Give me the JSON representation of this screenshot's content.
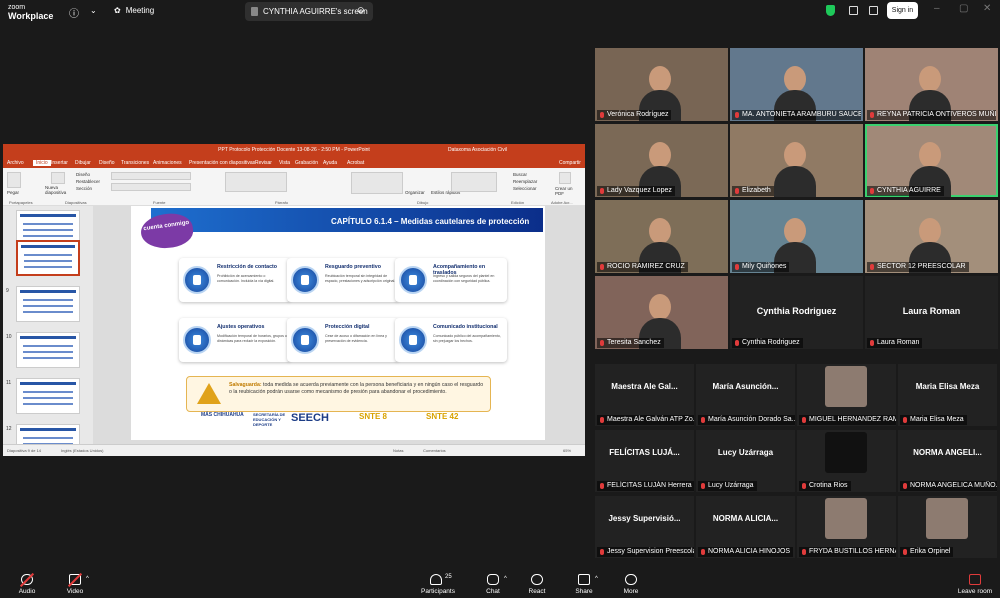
{
  "topbar": {
    "brand_small": "zoom",
    "brand_name": "Workplace",
    "meeting_label": "Meeting",
    "share_tab": "CYNTHIA AGUIRRE's screen",
    "sign_in": "Sign in"
  },
  "ppt": {
    "window_title": "PPT Protocolo Protección Docente 13-08-26 - 2:50 PM - PowerPoint",
    "user": "Dataxoma Asociación Civil",
    "tabs": [
      "Archivo",
      "Inicio",
      "Insertar",
      "Dibujar",
      "Diseño",
      "Transiciones",
      "Animaciones",
      "Presentación con diapositivas",
      "Revisar",
      "Vista",
      "Grabación",
      "Ayuda",
      "Acrobat",
      "Compartir"
    ],
    "ribbon_groups": [
      "Portapapeles",
      "Diapositivas",
      "Fuente",
      "Párrafo",
      "Dibujo",
      "Edición",
      "Adobe Acr..."
    ],
    "ribbon_items": {
      "new_slide": "Nueva diapositiva",
      "layout": "Diseño",
      "reset": "Restablecer",
      "section": "Sección",
      "paste": "Pegar",
      "find": "Buscar",
      "replace": "Reemplazar",
      "select": "Seleccionar",
      "organize": "Organizar",
      "quick_styles": "Estilos rápidos",
      "create_pdf": "Crear un PDF"
    },
    "thumb_numbers": [
      "9",
      "10",
      "11",
      "12",
      "13"
    ],
    "status": {
      "slide_of": "Diapositiva 9 de 14",
      "language": "Inglés (Estados Unidos)",
      "notes": "Notas",
      "comments": "Comentarios",
      "zoom": "65%"
    }
  },
  "slide": {
    "title": "CAPÍTULO 6.1.4 – Medidas cautelares de protección",
    "badge": "cuenta conmigo",
    "cards": [
      {
        "title": "Restricción de contacto",
        "desc": "Prohibición de acercamiento o comunicación. Incluida la vía digital."
      },
      {
        "title": "Resguardo preventivo",
        "desc": "Reubicación temporal sin integridad de espacio, prestaciones y adscripción original."
      },
      {
        "title": "Acompañamiento en traslados",
        "desc": "Ingreso y salida seguros del plantel en coordinación con seguridad pública."
      },
      {
        "title": "Ajustes operativos",
        "desc": "Modificación temporal de horarios, grupos o dinámicas para reducir la exposición."
      },
      {
        "title": "Protección digital",
        "desc": "Cese de acoso o difamación en línea y preservación de evidencia."
      },
      {
        "title": "Comunicado institucional",
        "desc": "Comunicado público del acompañamiento, sin prejuzgar los hechos."
      }
    ],
    "warning_label": "Salvaguarda:",
    "warning_text": "toda medida se acuerda previamente con la persona beneficiaria y en ningún caso el resguardo o la reubicación podrán usarse como mecanismo de presión para abandonar el procedimiento.",
    "logos": [
      "MÁS CHIHUAHUA",
      "SECRETARÍA DE EDUCACIÓN Y DEPORTE",
      "SEECH",
      "SNTE 8",
      "SNTE 42"
    ]
  },
  "participants": [
    {
      "name": "Verónica Rodríguez",
      "type": "video"
    },
    {
      "name": "MA. ANTONIETA ARAMBURU SAUCEDO",
      "type": "video"
    },
    {
      "name": "REYNA PATRICIA ONTIVEROS MUÑIZ",
      "type": "video"
    },
    {
      "name": "Lady Vazquez Lopez",
      "type": "video"
    },
    {
      "name": "Elizabeth",
      "type": "video"
    },
    {
      "name": "CYNTHIA AGUIRRE",
      "type": "video",
      "active": true
    },
    {
      "name": "ROCIO RAMIREZ CRUZ",
      "type": "video"
    },
    {
      "name": "Mily Quiñones",
      "type": "video"
    },
    {
      "name": "SECTOR 12 PREESCOLAR",
      "type": "video"
    },
    {
      "name": "Teresita Sanchez",
      "type": "video"
    },
    {
      "name": "Cynthia Rodriguez",
      "type": "name",
      "big": "Cynthia Rodriguez"
    },
    {
      "name": "Laura Roman",
      "type": "name",
      "big": "Laura Roman"
    },
    {
      "name": "Maestra Ale Galván ATP Zo...",
      "type": "name",
      "big": "Maestra Ale Gal..."
    },
    {
      "name": "María Asunción Dorado Sa...",
      "type": "name",
      "big": "María Asunción..."
    },
    {
      "name": "MIGUEL HERNANDEZ RAM...",
      "type": "avatar"
    },
    {
      "name": "Maria Elisa Meza",
      "type": "name",
      "big": "Maria Elisa Meza"
    },
    {
      "name": "FELÍCITAS LUJÁN Herrera",
      "type": "name",
      "big": "FELÍCITAS LUJÁ..."
    },
    {
      "name": "Lucy Uzárraga",
      "type": "name",
      "big": "Lucy Uzárraga"
    },
    {
      "name": "Crotina Rios",
      "type": "avatar-dark"
    },
    {
      "name": "NORMA ANGELICA MUÑO...",
      "type": "name",
      "big": "NORMA ANGELI..."
    },
    {
      "name": "Jessy Supervision Preescolar",
      "type": "name",
      "big": "Jessy Supervisió..."
    },
    {
      "name": "NORMA ALICIA HINOJOS",
      "type": "name",
      "big": "NORMA ALICIA..."
    },
    {
      "name": "FRYDA BUSTILLOS HERNAN...",
      "type": "avatar"
    },
    {
      "name": "Erika Orpinel",
      "type": "avatar"
    }
  ],
  "bottombar": {
    "audio": "Audio",
    "video": "Video",
    "participants": "Participants",
    "participants_count": "25",
    "chat": "Chat",
    "react": "React",
    "share": "Share",
    "more": "More",
    "leave": "Leave room"
  }
}
